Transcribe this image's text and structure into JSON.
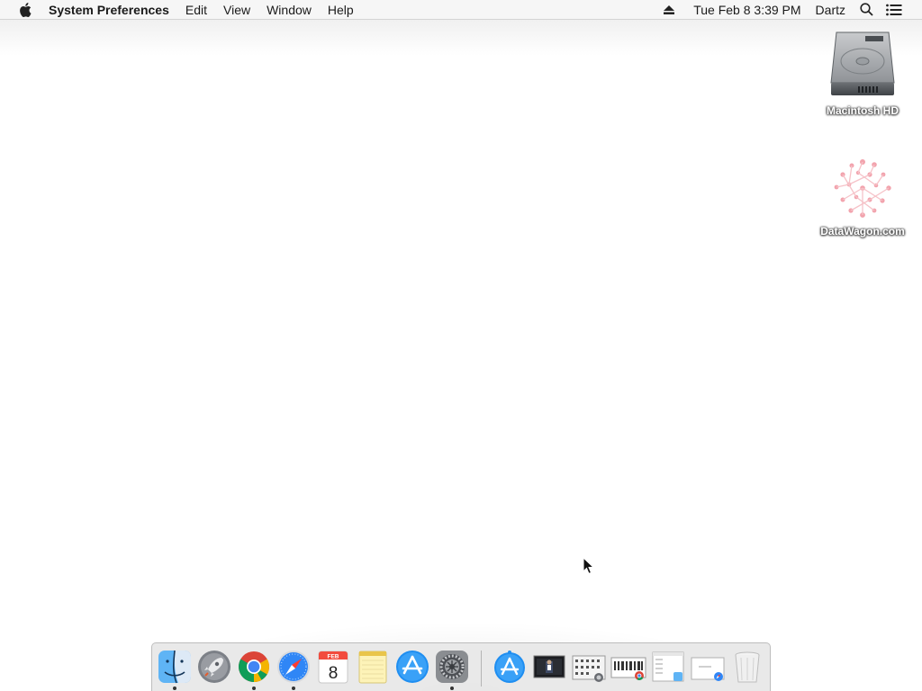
{
  "menubar": {
    "apple_icon": "apple-logo-icon",
    "app_name": "System Preferences",
    "menus": [
      "Edit",
      "View",
      "Window",
      "Help"
    ],
    "eject_icon": "eject-icon",
    "datetime": "Tue Feb 8  3:39 PM",
    "user": "Dartz",
    "search_icon": "spotlight-search-icon",
    "notification_icon": "notification-center-icon"
  },
  "desktop": {
    "icons": [
      {
        "label": "Macintosh HD",
        "icon": "hard-drive-icon"
      },
      {
        "label": "DataWagon.com",
        "icon": "network-volume-icon"
      }
    ]
  },
  "dock": {
    "apps": [
      {
        "name": "Finder",
        "icon": "finder-icon",
        "running": true
      },
      {
        "name": "Launchpad",
        "icon": "launchpad-icon",
        "running": false
      },
      {
        "name": "Google Chrome",
        "icon": "chrome-icon",
        "running": true
      },
      {
        "name": "Safari",
        "icon": "safari-icon",
        "running": true
      },
      {
        "name": "Calendar",
        "icon": "calendar-icon",
        "running": false,
        "month": "FEB",
        "day": "8"
      },
      {
        "name": "Notes",
        "icon": "notes-icon",
        "running": false
      },
      {
        "name": "App Store",
        "icon": "app-store-icon",
        "running": false
      },
      {
        "name": "System Preferences",
        "icon": "system-preferences-icon",
        "running": true
      }
    ],
    "others": [
      {
        "name": "Applications",
        "icon": "applications-folder-icon"
      },
      {
        "name": "Document",
        "icon": "document-thumbnail-icon"
      },
      {
        "name": "Screenshot",
        "icon": "screenshot-thumbnail-icon"
      },
      {
        "name": "Downloads",
        "icon": "downloads-stack-icon"
      },
      {
        "name": "File",
        "icon": "file-stack-icon"
      },
      {
        "name": "Safari file",
        "icon": "safari-file-icon"
      },
      {
        "name": "Trash",
        "icon": "trash-icon"
      }
    ]
  },
  "colors": {
    "menubar_bg": "#f6f6f6",
    "desktop_bg": "#ffffff",
    "dock_bg": "#e8e8e8"
  }
}
